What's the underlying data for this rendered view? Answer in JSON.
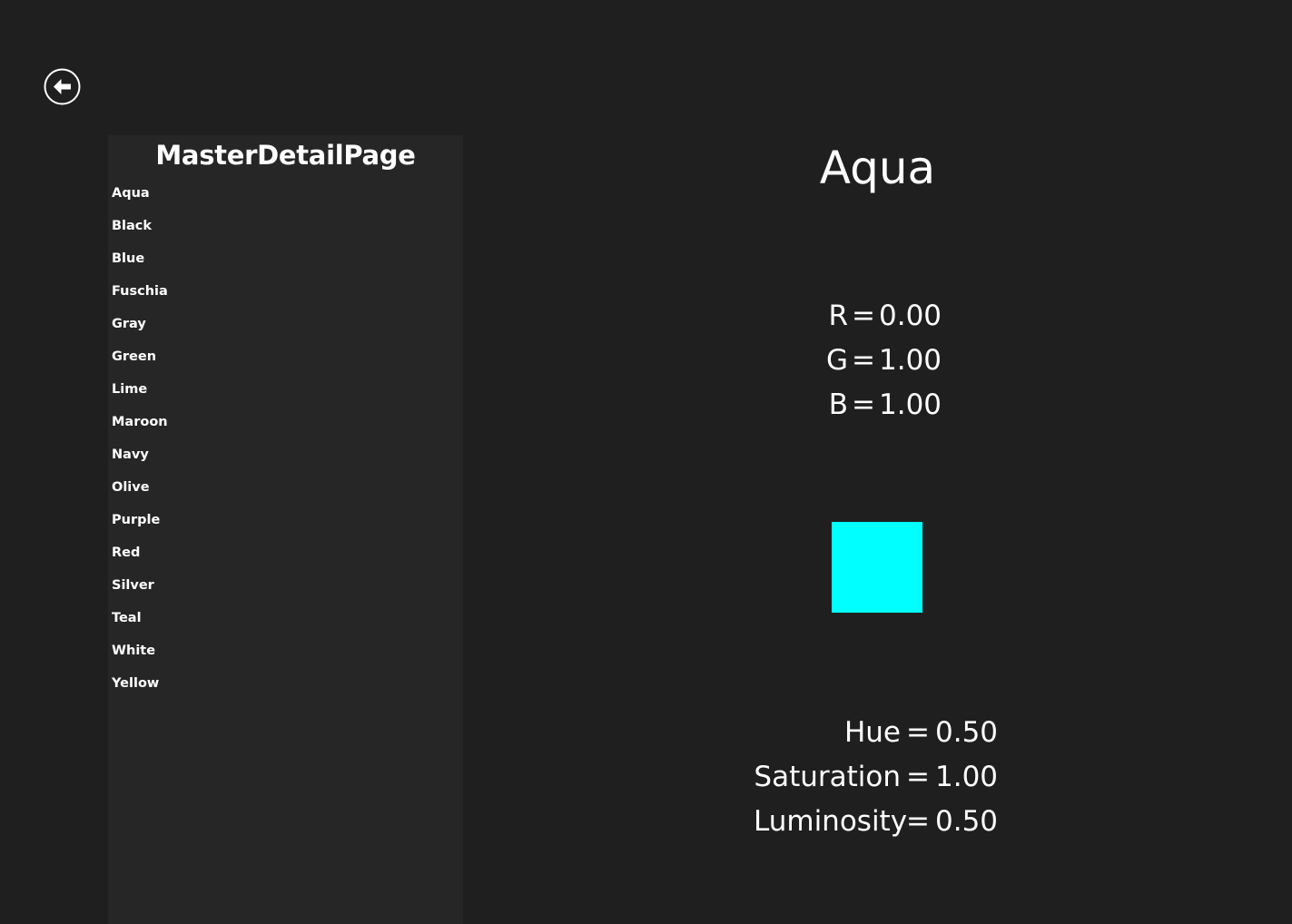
{
  "back_button": {
    "icon": "back-arrow-icon"
  },
  "master": {
    "title": "MasterDetailPage",
    "items": [
      {
        "label": "Aqua"
      },
      {
        "label": "Black"
      },
      {
        "label": "Blue"
      },
      {
        "label": "Fuschia"
      },
      {
        "label": "Gray"
      },
      {
        "label": "Green"
      },
      {
        "label": "Lime"
      },
      {
        "label": "Maroon"
      },
      {
        "label": "Navy"
      },
      {
        "label": "Olive"
      },
      {
        "label": "Purple"
      },
      {
        "label": "Red"
      },
      {
        "label": "Silver"
      },
      {
        "label": "Teal"
      },
      {
        "label": "White"
      },
      {
        "label": "Yellow"
      }
    ]
  },
  "detail": {
    "title": "Aqua",
    "rgb": [
      {
        "label": "R",
        "eq": "=",
        "value": "0.00"
      },
      {
        "label": "G",
        "eq": "=",
        "value": "1.00"
      },
      {
        "label": "B",
        "eq": "=",
        "value": "1.00"
      }
    ],
    "swatch_color": "#00FFFF",
    "hsl": [
      {
        "label": "Hue",
        "eq": "=",
        "value": "0.50"
      },
      {
        "label": "Saturation",
        "eq": "=",
        "value": "1.00"
      },
      {
        "label": "Luminosity",
        "eq": "=",
        "value": "0.50"
      }
    ]
  },
  "colors": {
    "background": "#1f1f1f",
    "master_background": "#262626",
    "text": "#ffffff"
  }
}
